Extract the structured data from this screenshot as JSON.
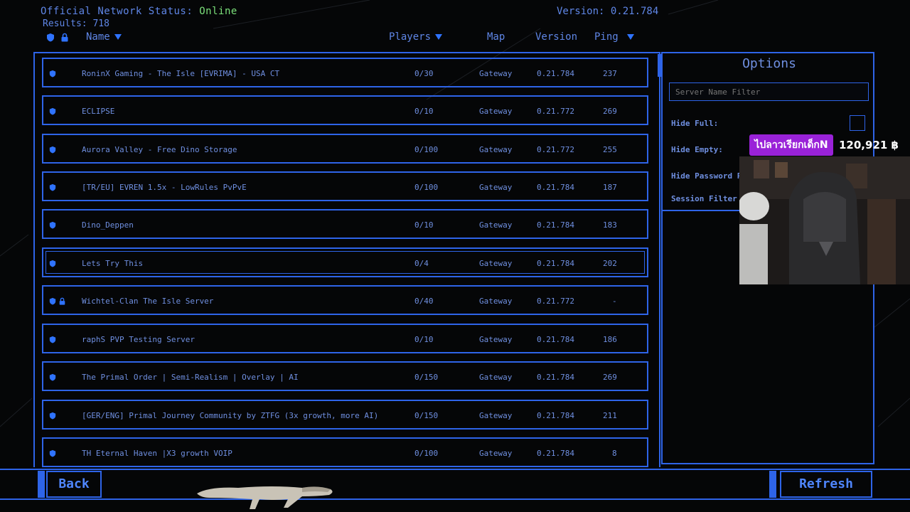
{
  "header": {
    "network_status_label": "Official Network Status:",
    "network_status_value": "Online",
    "results_label": "Results:",
    "results_count": "718",
    "version_label": "Version: 0.21.784"
  },
  "columns": {
    "name": "Name",
    "players": "Players",
    "map": "Map",
    "version": "Version",
    "ping": "Ping"
  },
  "servers": [
    {
      "name": "RoninX Gaming - The Isle [EVRIMA] - USA CT",
      "players": "0/30",
      "map": "Gateway",
      "version": "0.21.784",
      "ping": "237",
      "locked": false
    },
    {
      "name": "ECLIPSE",
      "players": "0/10",
      "map": "Gateway",
      "version": "0.21.772",
      "ping": "269",
      "locked": false
    },
    {
      "name": "Aurora Valley - Free Dino Storage",
      "players": "0/100",
      "map": "Gateway",
      "version": "0.21.772",
      "ping": "255",
      "locked": false
    },
    {
      "name": "[TR/EU] EVREN 1.5x - LowRules PvPvE",
      "players": "0/100",
      "map": "Gateway",
      "version": "0.21.784",
      "ping": "187",
      "locked": false
    },
    {
      "name": "Dino_Deppen",
      "players": "0/10",
      "map": "Gateway",
      "version": "0.21.784",
      "ping": "183",
      "locked": false
    },
    {
      "name": "Lets Try This",
      "players": "0/4",
      "map": "Gateway",
      "version": "0.21.784",
      "ping": "202",
      "locked": false,
      "selected": true
    },
    {
      "name": "Wichtel-Clan The Isle Server",
      "players": "0/40",
      "map": "Gateway",
      "version": "0.21.772",
      "ping": "-",
      "locked": true
    },
    {
      "name": "raphS PVP Testing Server",
      "players": "0/10",
      "map": "Gateway",
      "version": "0.21.784",
      "ping": "186",
      "locked": false
    },
    {
      "name": "The Primal Order | Semi-Realism | Overlay | AI",
      "players": "0/150",
      "map": "Gateway",
      "version": "0.21.784",
      "ping": "269",
      "locked": false
    },
    {
      "name": "[GER/ENG] Primal Journey Community by ZTFG (3x growth, more AI)",
      "players": "0/150",
      "map": "Gateway",
      "version": "0.21.784",
      "ping": "211",
      "locked": false
    },
    {
      "name": "TH Eternal Haven |X3 growth VOIP",
      "players": "0/100",
      "map": "Gateway",
      "version": "0.21.784",
      "ping": "8",
      "locked": false
    }
  ],
  "options": {
    "title": "Options",
    "filter_placeholder": "Server Name Filter",
    "hide_full": "Hide Full:",
    "hide_empty": "Hide Empty:",
    "hide_password": "Hide Password P",
    "session_filter": "Session Filter"
  },
  "overlay": {
    "badge_text": "ไปลาวเรียกเด็กN",
    "amount": "120,921 ฿"
  },
  "buttons": {
    "back": "Back",
    "refresh": "Refresh"
  },
  "colors": {
    "accent": "#2e64e8",
    "text": "#6f8fe0",
    "online": "#7be07a",
    "background": "#050607"
  }
}
